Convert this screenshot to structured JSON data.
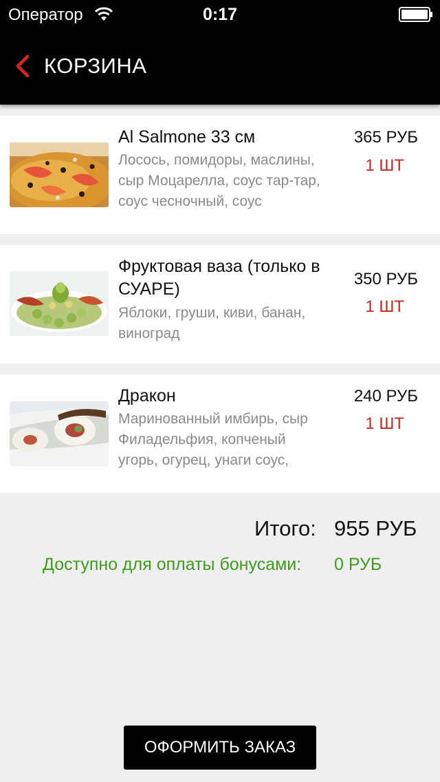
{
  "status_bar": {
    "carrier": "Оператор",
    "time": "0:17",
    "wifi_icon": "wifi-icon",
    "battery_icon": "battery-icon"
  },
  "nav": {
    "back_icon": "chevron-left-icon",
    "title": "КОРЗИНА"
  },
  "colors": {
    "accent_red": "#c8261e",
    "bonus_green": "#3e9b1e",
    "bar_black": "#000000",
    "background": "#efefef"
  },
  "cart": {
    "items": [
      {
        "name": "Al Salmone 33 см",
        "description": "Лосось, помидоры, маслины, сыр Моцарелла, соус тар-тар, соус чесночный, соус",
        "price": "365 РУБ",
        "quantity": "1 ШТ",
        "image": "pizza-image"
      },
      {
        "name": "Фруктовая ваза (только в СУАРЕ)",
        "description": "Яблоки, груши, киви, банан, виноград",
        "price": "350 РУБ",
        "quantity": "1 ШТ",
        "image": "fruit-plate-image"
      },
      {
        "name": "Дракон",
        "description": "Маринованный имбирь, сыр Филадельфия, копченый угорь, огурец, унаги соус,",
        "price": "240 РУБ",
        "quantity": "1 ШТ",
        "image": "sushi-roll-image"
      }
    ]
  },
  "summary": {
    "total_label": "Итого:",
    "total_value": "955 РУБ",
    "bonus_label": "Доступно для оплаты бонусами:",
    "bonus_value": "0 РУБ"
  },
  "order_button": {
    "label": "ОФОРМИТЬ ЗАКАЗ"
  }
}
